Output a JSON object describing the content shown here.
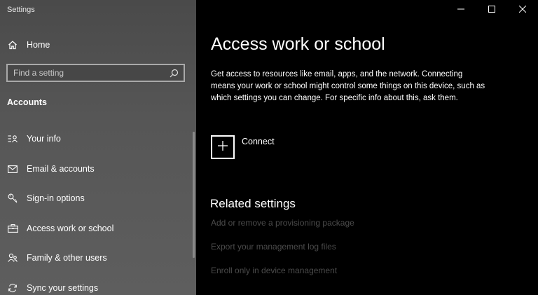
{
  "window": {
    "app_title": "Settings",
    "controls": {
      "minimize": "minimize-icon",
      "maximize": "maximize-icon",
      "close": "close-icon"
    }
  },
  "sidebar": {
    "home_label": "Home",
    "search": {
      "placeholder": "Find a setting",
      "value": ""
    },
    "section_heading": "Accounts",
    "items": [
      {
        "label": "Your info",
        "icon": "person-card-icon"
      },
      {
        "label": "Email & accounts",
        "icon": "envelope-icon"
      },
      {
        "label": "Sign-in options",
        "icon": "key-icon"
      },
      {
        "label": "Access work or school",
        "icon": "briefcase-icon"
      },
      {
        "label": "Family & other users",
        "icon": "people-icon"
      },
      {
        "label": "Sync your settings",
        "icon": "sync-icon"
      }
    ]
  },
  "main": {
    "title": "Access work or school",
    "description": "Get access to resources like email, apps, and the network. Connecting means your work or school might control some things on this device, such as which settings you can change. For specific info about this, ask them.",
    "connect_label": "Connect",
    "related_heading": "Related settings",
    "related_links": [
      "Add or remove a provisioning package",
      "Export your management log files",
      "Enroll only in device management"
    ]
  },
  "colors": {
    "sidebar_bg": "#565656",
    "main_bg": "#000000",
    "text": "#ffffff",
    "disabled_link": "#4b4b4b"
  }
}
